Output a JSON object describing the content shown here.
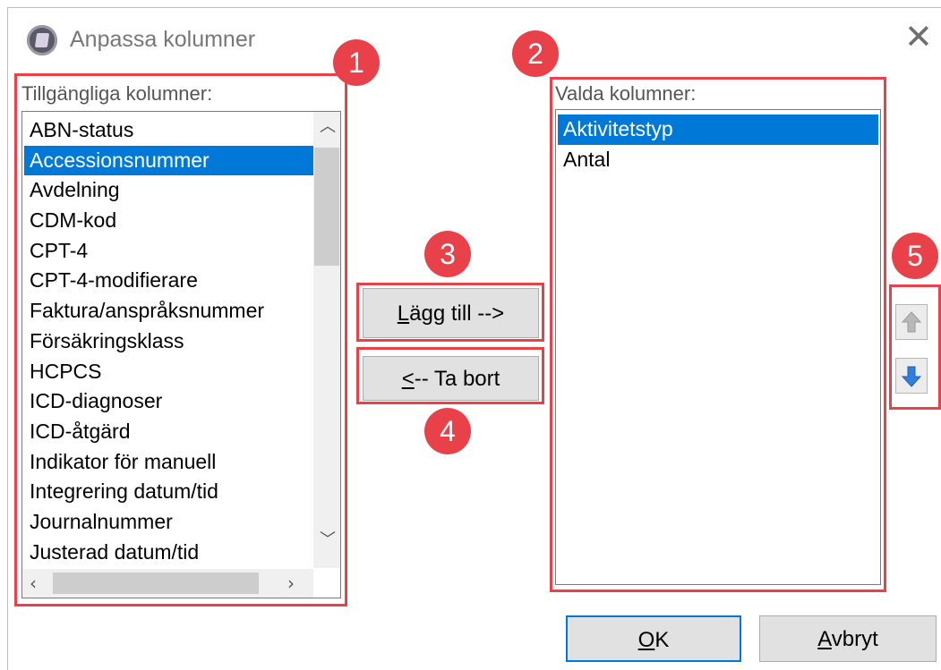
{
  "window": {
    "title": "Anpassa kolumner",
    "close_glyph": "✕"
  },
  "available": {
    "label": "Tillgängliga kolumner:",
    "items": [
      {
        "label": "ABN-status",
        "selected": false
      },
      {
        "label": "Accessionsnummer",
        "selected": true
      },
      {
        "label": "Avdelning",
        "selected": false
      },
      {
        "label": "CDM-kod",
        "selected": false
      },
      {
        "label": "CPT-4",
        "selected": false
      },
      {
        "label": "CPT-4-modifierare",
        "selected": false
      },
      {
        "label": "Faktura/anspråksnummer",
        "selected": false
      },
      {
        "label": "Försäkringsklass",
        "selected": false
      },
      {
        "label": "HCPCS",
        "selected": false
      },
      {
        "label": "ICD-diagnoser",
        "selected": false
      },
      {
        "label": "ICD-åtgärd",
        "selected": false
      },
      {
        "label": "Indikator för manuell",
        "selected": false
      },
      {
        "label": "Integrering datum/tid",
        "selected": false
      },
      {
        "label": "Journalnummer",
        "selected": false
      },
      {
        "label": "Justerad datum/tid",
        "selected": false
      }
    ]
  },
  "selected_columns": {
    "label": "Valda kolumner:",
    "items": [
      {
        "label": "Aktivitetstyp",
        "selected": true
      },
      {
        "label": "Antal",
        "selected": false
      }
    ]
  },
  "buttons": {
    "add": {
      "mnemonic": "L",
      "rest": "ägg till -->"
    },
    "remove": {
      "mnemonic": "<",
      "rest": "-- Ta bort"
    },
    "ok": {
      "mnemonic": "O",
      "rest": "K"
    },
    "cancel": {
      "mnemonic": "A",
      "rest": "vbryt"
    }
  },
  "callouts": [
    "1",
    "2",
    "3",
    "4",
    "5"
  ],
  "icons": {
    "up": "arrow-up-icon",
    "down": "arrow-down-icon"
  },
  "colors": {
    "highlight": "#0078d7",
    "callout": "#e84149",
    "down_arrow": "#2f7fe0",
    "up_arrow_disabled": "#b8b8b8"
  }
}
